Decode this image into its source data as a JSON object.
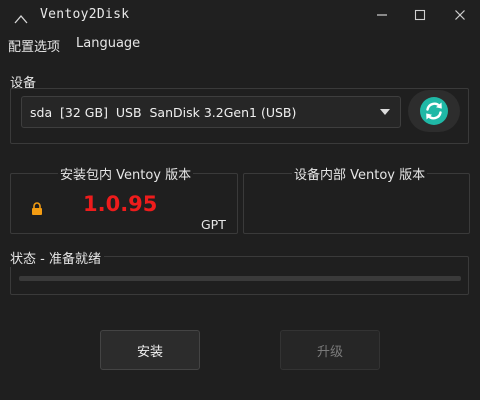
{
  "window": {
    "title": "Ventoy2Disk",
    "controls": [
      "minimize",
      "maximize",
      "close"
    ]
  },
  "menu": {
    "items": [
      {
        "label": "配置选项"
      },
      {
        "label": "Language"
      }
    ]
  },
  "device": {
    "group_label": "设备",
    "selected": "sda  [32 GB]  USB  SanDisk 3.2Gen1 (USB)",
    "refresh_icon": "refresh-icon",
    "refresh_color": "#1fb8a6"
  },
  "versions": {
    "package": {
      "title": "安装包内 Ventoy 版本",
      "version": "1.0.95",
      "partition_style": "GPT",
      "lock_icon": "lock-icon",
      "version_color": "#ee1c1c"
    },
    "device": {
      "title": "设备内部 Ventoy 版本",
      "version": ""
    }
  },
  "status": {
    "label": "状态 - 准备就绪",
    "progress": 0
  },
  "buttons": {
    "install": {
      "label": "安装",
      "enabled": true
    },
    "update": {
      "label": "升级",
      "enabled": false
    }
  }
}
